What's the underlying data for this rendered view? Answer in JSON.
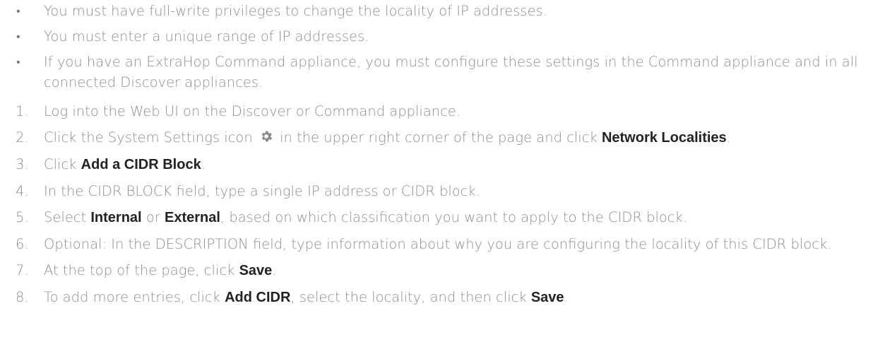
{
  "bullets": [
    "You must have full-write privileges to change the locality of IP addresses.",
    "You must enter a unique range of IP addresses.",
    "If you have an ExtraHop Command appliance, you must configure these settings in the Command appliance and in all connected Discover appliances."
  ],
  "steps": {
    "s1": {
      "num": "1.",
      "text": "Log into the Web UI on the Discover or Command appliance."
    },
    "s2": {
      "num": "2.",
      "pre": "Click the System Settings icon",
      "mid": "in the upper right corner of the page and click",
      "bold": "Network Localities",
      "post": "."
    },
    "s3": {
      "num": "3.",
      "pre": "Click",
      "bold": "Add a CIDR Block",
      "post": "."
    },
    "s4": {
      "num": "4.",
      "text": "In the CIDR BLOCK field, type a single IP address or CIDR block."
    },
    "s5": {
      "num": "5.",
      "pre": "Select",
      "bold1": "Internal",
      "mid": "or",
      "bold2": "External",
      "post": ", based on which classification you want to apply to the CIDR block."
    },
    "s6": {
      "num": "6.",
      "text": "Optional: In the DESCRIPTION field, type information about why you are configuring the locality of this CIDR block."
    },
    "s7": {
      "num": "7.",
      "pre": "At the top of the page, click",
      "bold": "Save",
      "post": "."
    },
    "s8": {
      "num": "8.",
      "pre": "To add more entries, click",
      "bold1": "Add CIDR",
      "mid": ", select the locality, and then click",
      "bold2": "Save",
      "post": "."
    }
  },
  "icons": {
    "settings": "gear-icon"
  },
  "colors": {
    "body_text": "#8c8c8c",
    "bold_text": "#222222",
    "icon": "#8a8a8a"
  }
}
